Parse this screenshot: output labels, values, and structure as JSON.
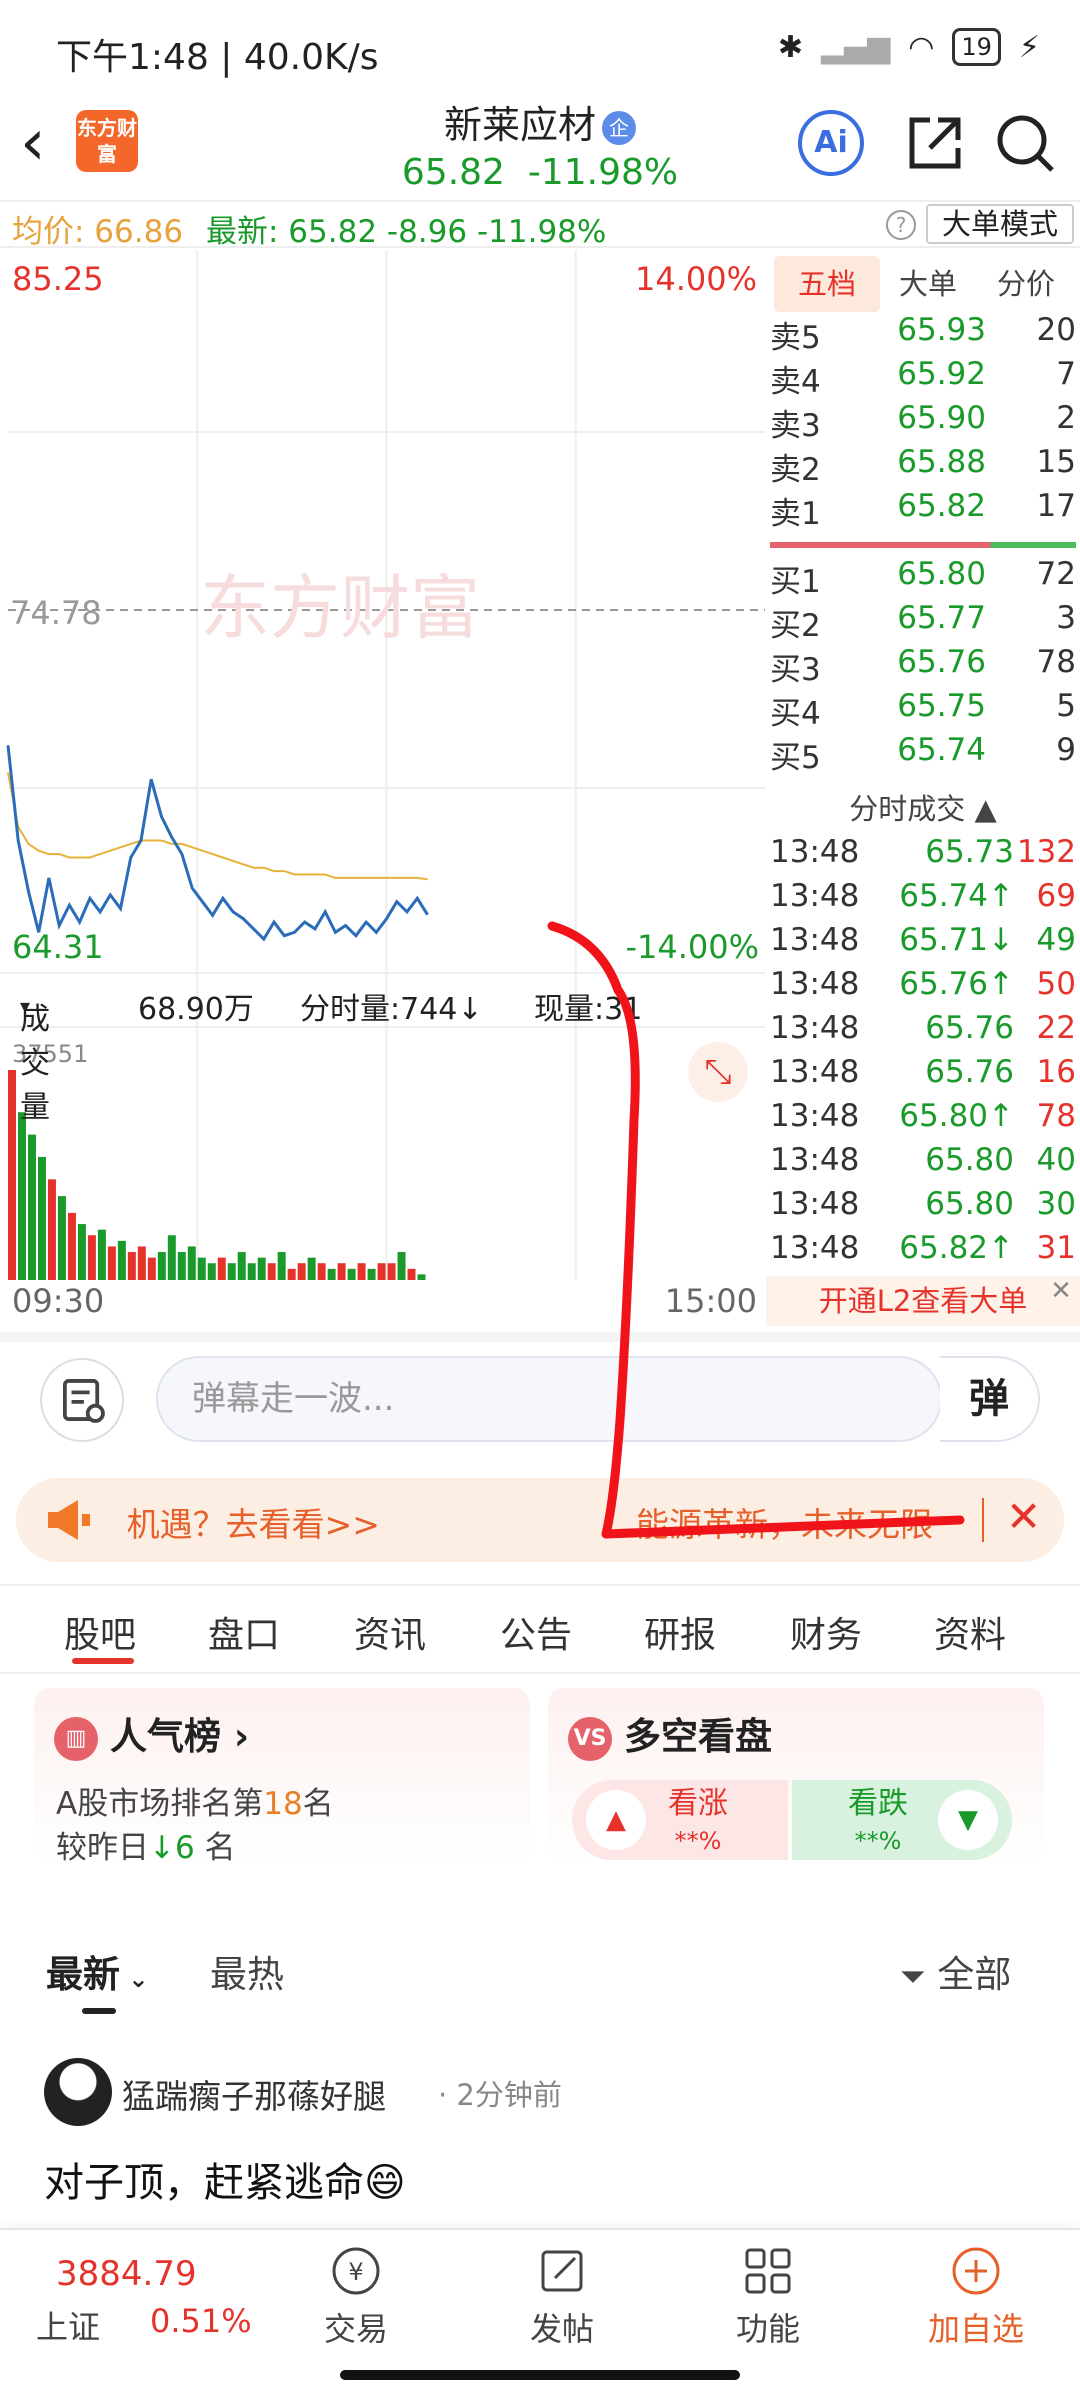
{
  "status_bar": {
    "time": "下午1:48 | 40.0K/s",
    "battery": "19"
  },
  "nav": {
    "logo": "东方财富",
    "title": "新莱应材",
    "badge": "企",
    "price": "65.82",
    "change_pct": "-11.98%",
    "ai_label": "Ai"
  },
  "info_row": {
    "avg_label": "均价: 66.86",
    "latest_label": "最新: 65.82  -8.96  -11.98%",
    "help": "?",
    "big_order_btn": "大单模式"
  },
  "chart": {
    "high": "85.25",
    "high_pct": "14.00%",
    "mid": "74.78",
    "low": "64.31",
    "low_pct": "-14.00%",
    "vol_peak": "37551",
    "time_start": "09:30",
    "time_end": "15:00",
    "volume_label": "成交量",
    "volume_value": "68.90万",
    "minute_vol": "分时量:744↓",
    "current_vol": "现量:31",
    "colors": {
      "price_line": "#2b6cb8",
      "avg_line": "#e6b23a",
      "up": "#e5332c",
      "down": "#1a9a2a"
    }
  },
  "chart_data": {
    "type": "line",
    "title": "",
    "xlabel": "",
    "ylabel": "",
    "x_range": [
      "09:30",
      "15:00"
    ],
    "ylim": [
      64.31,
      85.25
    ],
    "reference": 74.78,
    "series": [
      {
        "values": [
          70.8,
          68.0,
          66.5,
          65.3,
          66.9,
          65.5,
          66.1,
          65.6,
          66.3,
          65.9,
          66.4,
          66.0,
          67.5,
          68.0,
          69.8,
          68.7,
          68.1,
          67.6,
          66.6,
          66.2,
          65.8,
          66.3,
          65.9,
          65.7,
          65.4,
          65.1,
          65.6,
          65.2,
          65.3,
          65.6,
          65.4,
          65.9,
          65.3,
          65.5,
          65.2,
          65.6,
          65.3,
          65.7,
          66.2,
          65.9,
          66.3,
          65.82
        ]
      },
      {
        "values": [
          70.0,
          68.4,
          67.9,
          67.7,
          67.6,
          67.6,
          67.5,
          67.5,
          67.5,
          67.6,
          67.7,
          67.8,
          67.9,
          68.0,
          68.0,
          68.0,
          67.9,
          67.9,
          67.8,
          67.7,
          67.6,
          67.5,
          67.4,
          67.3,
          67.2,
          67.2,
          67.1,
          67.1,
          67.0,
          67.0,
          67.0,
          67.0,
          66.9,
          66.9,
          66.9,
          66.9,
          66.9,
          66.9,
          66.9,
          66.9,
          66.9,
          66.86
        ]
      }
    ],
    "volume_ylim": [
      0,
      37551
    ],
    "volume": [
      37551,
      30000,
      26000,
      22000,
      18000,
      15000,
      12000,
      10000,
      8000,
      9000,
      6000,
      7000,
      5000,
      6000,
      4000,
      5000,
      8000,
      5000,
      6000,
      4000,
      3000,
      4000,
      3000,
      5000,
      3000,
      4000,
      3000,
      5000,
      2000,
      3000,
      4000,
      3000,
      2000,
      3000,
      2000,
      3000,
      2000,
      3000,
      3000,
      5000,
      2000,
      1000
    ]
  },
  "order_book": {
    "tabs": [
      "五档",
      "大单",
      "分价"
    ],
    "asks": [
      {
        "label": "卖5",
        "price": "65.93",
        "vol": "20"
      },
      {
        "label": "卖4",
        "price": "65.92",
        "vol": "7"
      },
      {
        "label": "卖3",
        "price": "65.90",
        "vol": "2"
      },
      {
        "label": "卖2",
        "price": "65.88",
        "vol": "15"
      },
      {
        "label": "卖1",
        "price": "65.82",
        "vol": "17"
      }
    ],
    "bids": [
      {
        "label": "买1",
        "price": "65.80",
        "vol": "72"
      },
      {
        "label": "买2",
        "price": "65.77",
        "vol": "3"
      },
      {
        "label": "买3",
        "price": "65.76",
        "vol": "78"
      },
      {
        "label": "买4",
        "price": "65.75",
        "vol": "5"
      },
      {
        "label": "买5",
        "price": "65.74",
        "vol": "9"
      }
    ],
    "ticks_header": "分时成交 ▲",
    "ticks": [
      {
        "time": "13:48",
        "price": "65.73",
        "vol": "132",
        "dir": ""
      },
      {
        "time": "13:48",
        "price": "65.74↑",
        "vol": "69",
        "dir": "up"
      },
      {
        "time": "13:48",
        "price": "65.71↓",
        "vol": "49",
        "dir": "down"
      },
      {
        "time": "13:48",
        "price": "65.76↑",
        "vol": "50",
        "dir": "up"
      },
      {
        "time": "13:48",
        "price": "65.76",
        "vol": "22",
        "dir": ""
      },
      {
        "time": "13:48",
        "price": "65.76",
        "vol": "16",
        "dir": ""
      },
      {
        "time": "13:48",
        "price": "65.80↑",
        "vol": "78",
        "dir": "up"
      },
      {
        "time": "13:48",
        "price": "65.80",
        "vol": "40",
        "dir": "down"
      },
      {
        "time": "13:48",
        "price": "65.80",
        "vol": "30",
        "dir": "down"
      },
      {
        "time": "13:48",
        "price": "65.82↑",
        "vol": "31",
        "dir": "up"
      }
    ],
    "l2_banner": "开通L2查看大单"
  },
  "input": {
    "placeholder": "弹幕走一波...",
    "send": "弹"
  },
  "promo": {
    "left_text": " 机遇？去看看>>",
    "right_text": "能源革新，未来无限"
  },
  "main_tabs": [
    "股吧",
    "盘口",
    "资讯",
    "公告",
    "研报",
    "财务",
    "资料"
  ],
  "cards": {
    "popular": {
      "title": "人气榜 ›",
      "line1_pre": "A股市场排名第",
      "rank": "18",
      "line1_post": "名",
      "line2_pre": "较昨日",
      "change": "↓6",
      "line2_post": " 名"
    },
    "bullbear": {
      "title": "多空看盘",
      "bull": "看涨",
      "bull_val": "**%",
      "bear": "看跌",
      "bear_val": "**%"
    }
  },
  "feed": {
    "latest": "最新",
    "hot": "最热",
    "filter": "全部"
  },
  "post": {
    "author": "猛踹瘸子那蓧好腿",
    "time": "· 2分钟前",
    "body": "对子顶，赶紧逃命😄"
  },
  "bottom": {
    "index_value": "3884.79",
    "index_name": "上证",
    "index_change": "0.51%",
    "items": [
      "交易",
      "发帖",
      "功能",
      "加自选"
    ]
  }
}
